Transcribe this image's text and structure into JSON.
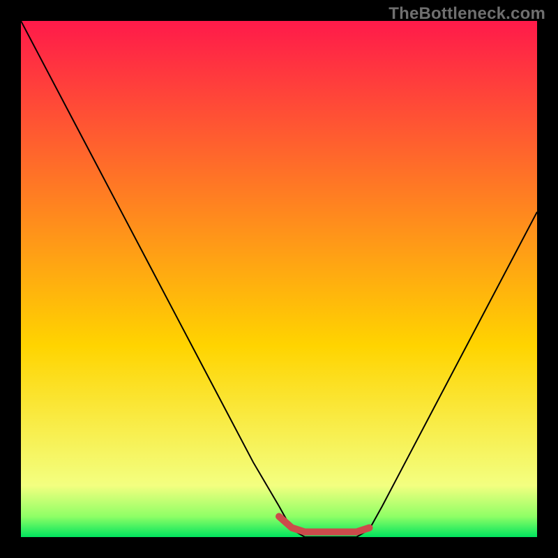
{
  "watermark": "TheBottleneck.com",
  "chart_data": {
    "type": "line",
    "title": "",
    "xlabel": "",
    "ylabel": "",
    "xlim": [
      0,
      1
    ],
    "ylim": [
      0,
      1
    ],
    "grid": false,
    "gradient": {
      "top_color": "#ff1a4a",
      "mid_color": "#ffd400",
      "bottom_band_color": "#8fff66",
      "bottom_line_color": "#00e45e"
    },
    "series": [
      {
        "name": "curve-black",
        "color": "#000000",
        "stroke_width": 2,
        "x": [
          0.0,
          0.05,
          0.1,
          0.15,
          0.2,
          0.25,
          0.3,
          0.35,
          0.4,
          0.45,
          0.5,
          0.525,
          0.55,
          0.6,
          0.65,
          0.675,
          0.7,
          0.75,
          0.8,
          0.85,
          0.9,
          0.95,
          1.0
        ],
        "y": [
          1.0,
          0.905,
          0.81,
          0.715,
          0.62,
          0.525,
          0.43,
          0.335,
          0.24,
          0.145,
          0.06,
          0.015,
          0.0,
          0.0,
          0.0,
          0.015,
          0.06,
          0.155,
          0.25,
          0.345,
          0.44,
          0.535,
          0.63
        ]
      },
      {
        "name": "flat-red-segment",
        "color": "#cc4b4b",
        "stroke_width": 10,
        "x": [
          0.5,
          0.525,
          0.55,
          0.6,
          0.65,
          0.675
        ],
        "y": [
          0.04,
          0.018,
          0.01,
          0.01,
          0.01,
          0.018
        ]
      }
    ],
    "comment": "Values are normalized 0–1 within the 740×740 plot region; y measured from the bottom of the gradient area."
  }
}
